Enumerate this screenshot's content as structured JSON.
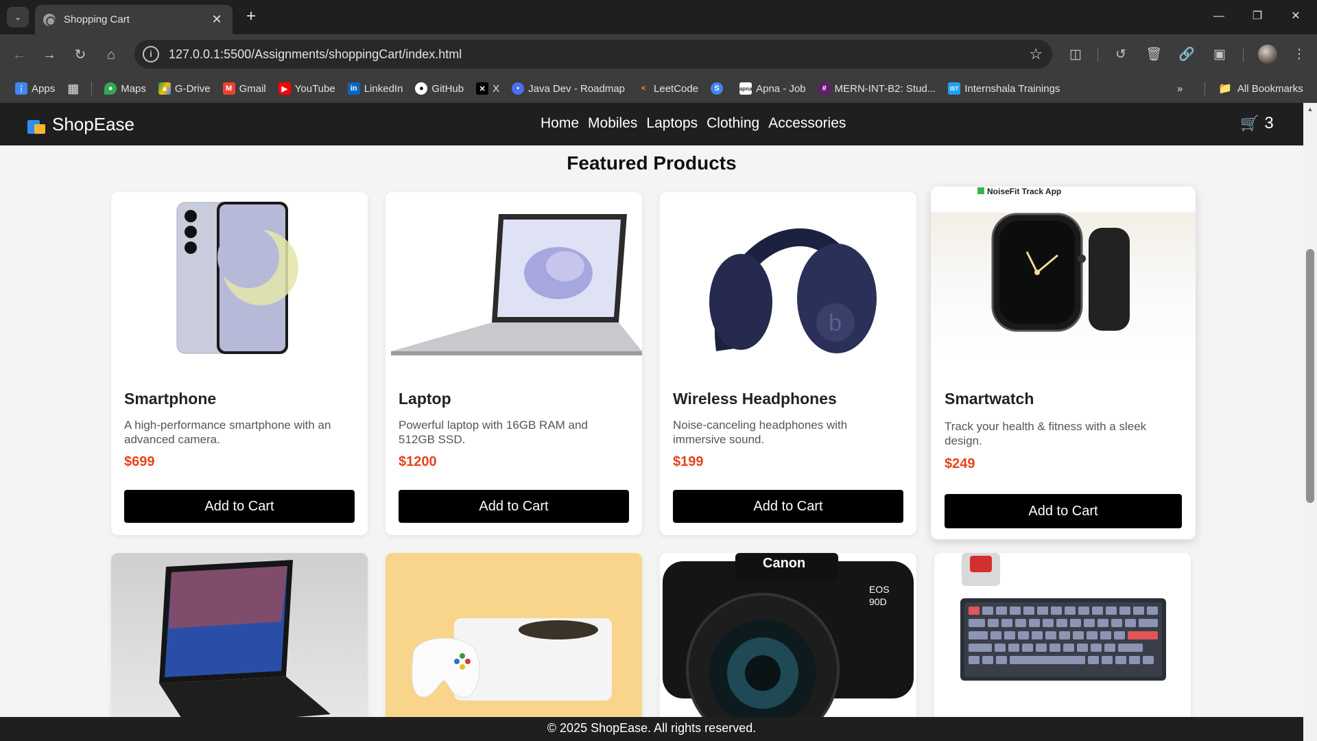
{
  "browser": {
    "tab_title": "Shopping Cart",
    "url": "127.0.0.1:5500/Assignments/shoppingCart/index.html",
    "bookmarks": [
      {
        "label": "Apps",
        "icon": "apps-grid-icon",
        "color": "#4285f4"
      },
      {
        "label": "Maps",
        "icon": "maps-icon",
        "color": "#34a853"
      },
      {
        "label": "G-Drive",
        "icon": "drive-icon",
        "color": "#fbbc04"
      },
      {
        "label": "Gmail",
        "icon": "gmail-icon",
        "color": "#ea4335"
      },
      {
        "label": "YouTube",
        "icon": "youtube-icon",
        "color": "#ff0000"
      },
      {
        "label": "LinkedIn",
        "icon": "linkedin-icon",
        "color": "#0a66c2"
      },
      {
        "label": "GitHub",
        "icon": "github-icon",
        "color": "#ffffff"
      },
      {
        "label": "X",
        "icon": "x-icon",
        "color": "#000000"
      },
      {
        "label": "Java Dev - Roadmap",
        "icon": "chat-icon",
        "color": "#4c6ef5"
      },
      {
        "label": "LeetCode",
        "icon": "leetcode-icon",
        "color": "#ffa116"
      },
      {
        "label": "",
        "icon": "swiggy-icon",
        "color": "#4285f4"
      },
      {
        "label": "Apna - Job",
        "icon": "apna-icon",
        "color": "#ffffff"
      },
      {
        "label": "MERN-INT-B2: Stud...",
        "icon": "slack-icon",
        "color": "#611f69"
      },
      {
        "label": "Internshala Trainings",
        "icon": "internshala-icon",
        "color": "#1da1f2"
      }
    ],
    "all_bookmarks": "All Bookmarks"
  },
  "site": {
    "name": "ShopEase",
    "nav": [
      "Home",
      "Mobiles",
      "Laptops",
      "Clothing",
      "Accessories"
    ],
    "cart_count": "3",
    "section_title": "Featured Products",
    "footer": "© 2025 ShopEase. All rights reserved."
  },
  "products": [
    {
      "name": "Smartphone",
      "description": "A high-performance smartphone with an advanced camera.",
      "price": "$699",
      "button": "Add to Cart"
    },
    {
      "name": "Laptop",
      "description": "Powerful laptop with 16GB RAM and 512GB SSD.",
      "price": "$1200",
      "button": "Add to Cart"
    },
    {
      "name": "Wireless Headphones",
      "description": "Noise-canceling headphones with immersive sound.",
      "price": "$199",
      "button": "Add to Cart"
    },
    {
      "name": "Smartwatch",
      "description": "Track your health & fitness with a sleek design.",
      "price": "$249",
      "button": "Add to Cart",
      "image_caption": "NoiseFit Track App"
    }
  ],
  "row2_images": [
    {
      "name": "tablet-image"
    },
    {
      "name": "console-image"
    },
    {
      "name": "camera-image",
      "caption": "Canon",
      "model": "EOS 90D"
    },
    {
      "name": "keyboard-image"
    }
  ],
  "colors": {
    "price": "#e8431c",
    "header_bg": "#1f1f1f",
    "page_bg": "#f4f4f4",
    "button_bg": "#000000"
  }
}
